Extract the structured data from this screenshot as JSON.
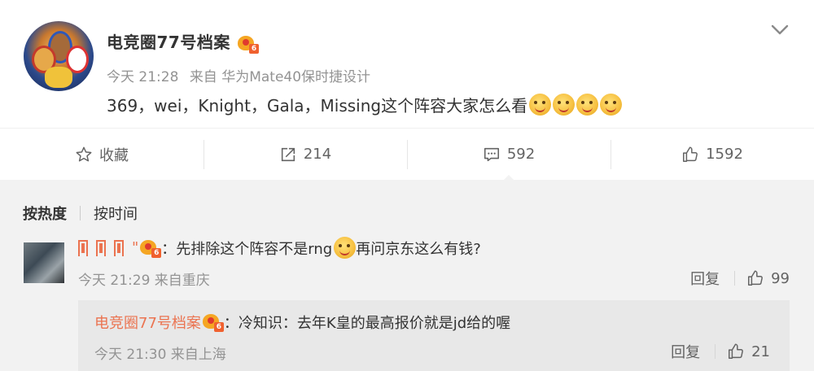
{
  "post": {
    "username": "电竞圈77号档案",
    "badge_num": "6",
    "time": "今天 21:28",
    "source": "来自 华为Mate40保时捷设计",
    "content": "369，wei，Knight，Gala，Missing这个阵容大家怎么看",
    "emoji_icons": [
      "drool-emoji-icon",
      "drool-emoji-icon",
      "drool-emoji-icon",
      "smile-emoji-icon"
    ]
  },
  "actions": {
    "favorite_label": "收藏",
    "repost_count": "214",
    "comment_count": "592",
    "like_count": "1592"
  },
  "comments": {
    "sort_hot": "按热度",
    "sort_time": "按时间",
    "items": [
      {
        "username_suffix": "\"",
        "badge_num": "6",
        "text_before": "：先排除这个阵容不是rng",
        "text_after": "再问京东这么有钱?",
        "time_source": "今天 21:29 来自重庆",
        "reply_label": "回复",
        "likes": "99",
        "reply": {
          "username": "电竞圈77号档案",
          "badge_num": "6",
          "text": "：冷知识：去年K皇的最高报价就是jd给的喔",
          "time_source": "今天 21:30 来自上海",
          "reply_label": "回复",
          "likes": "21"
        }
      }
    ]
  },
  "colors": {
    "accent_orange": "#eb7350",
    "meta_gray": "#939393",
    "comment_bg": "#f2f2f2",
    "reply_bg": "#e8e8e8"
  }
}
